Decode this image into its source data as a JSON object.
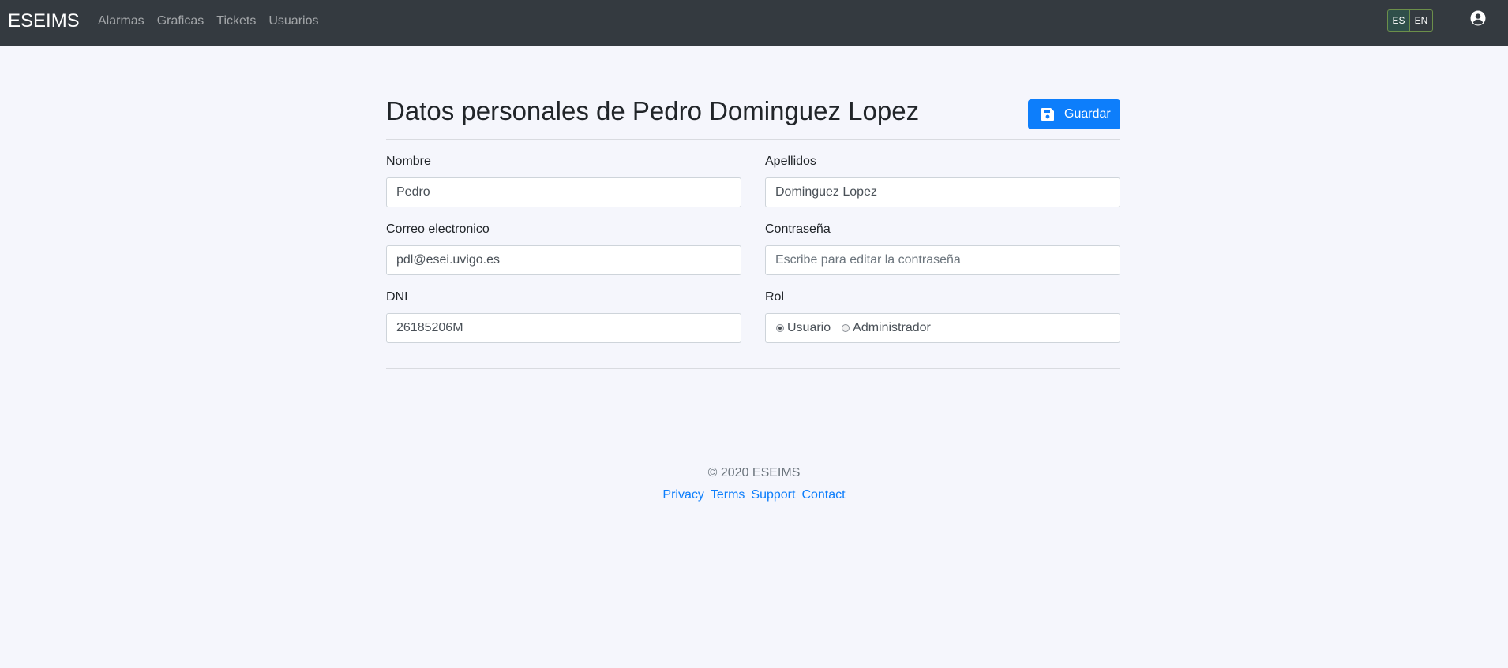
{
  "navbar": {
    "brand": "ESEIMS",
    "links": [
      "Alarmas",
      "Graficas",
      "Tickets",
      "Usuarios"
    ],
    "languages": [
      "ES",
      "EN"
    ],
    "active_language": "ES",
    "user_icon": "user-circle-icon"
  },
  "page": {
    "title": "Datos personales de Pedro Dominguez Lopez",
    "save_label": "Guardar",
    "save_icon": "floppy-disk-icon"
  },
  "form": {
    "nombre": {
      "label": "Nombre",
      "value": "Pedro"
    },
    "apellidos": {
      "label": "Apellidos",
      "value": "Dominguez Lopez"
    },
    "correo": {
      "label": "Correo electronico",
      "value": "pdl@esei.uvigo.es"
    },
    "contrasena": {
      "label": "Contraseña",
      "value": "",
      "placeholder": "Escribe para editar la contraseña"
    },
    "dni": {
      "label": "DNI",
      "value": "26185206M"
    },
    "rol": {
      "label": "Rol",
      "options": [
        "Usuario",
        "Administrador"
      ],
      "selected": "Usuario"
    }
  },
  "footer": {
    "copyright": "© 2020 ESEIMS",
    "links": [
      "Privacy",
      "Terms",
      "Support",
      "Contact"
    ]
  },
  "colors": {
    "navbar_bg": "#343a40",
    "primary": "#0d7efb",
    "page_bg": "#f5f6fc"
  }
}
